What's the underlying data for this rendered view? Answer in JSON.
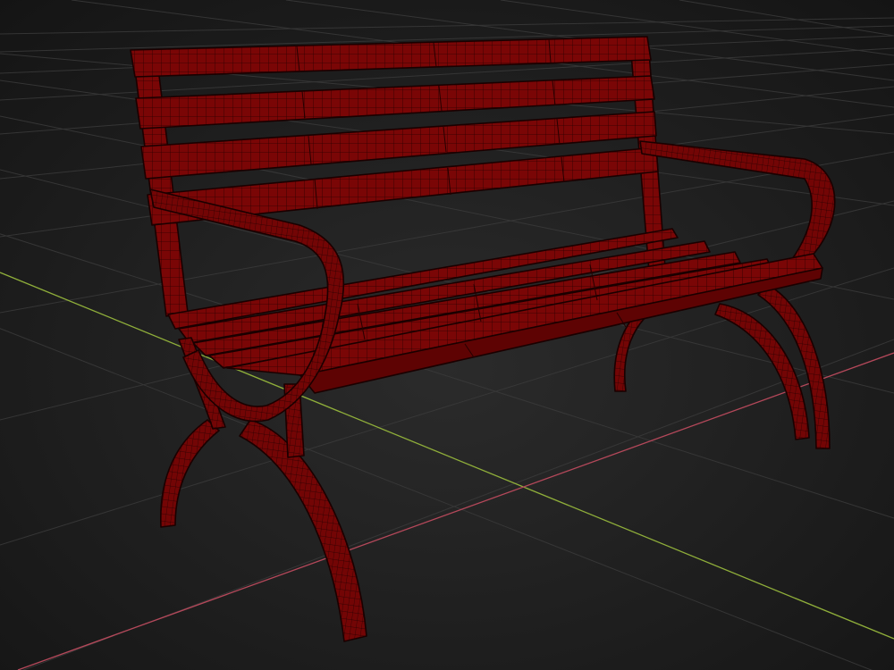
{
  "scene": {
    "object": "bench-model",
    "view": "perspective",
    "shading": "wireframe-on-shaded"
  },
  "colors": {
    "background_center": "#2b2b2b",
    "background_edge": "#141414",
    "grid_line": "#3a3a3a",
    "axis_x": "#b4485a",
    "axis_z": "#8fae3a",
    "bench_fill": "#7a0606",
    "bench_fill_dark": "#5e0303",
    "bench_wire": "#1a0000"
  },
  "icons": {
    "grid": "ground-grid-icon",
    "model": "park-bench-icon"
  }
}
